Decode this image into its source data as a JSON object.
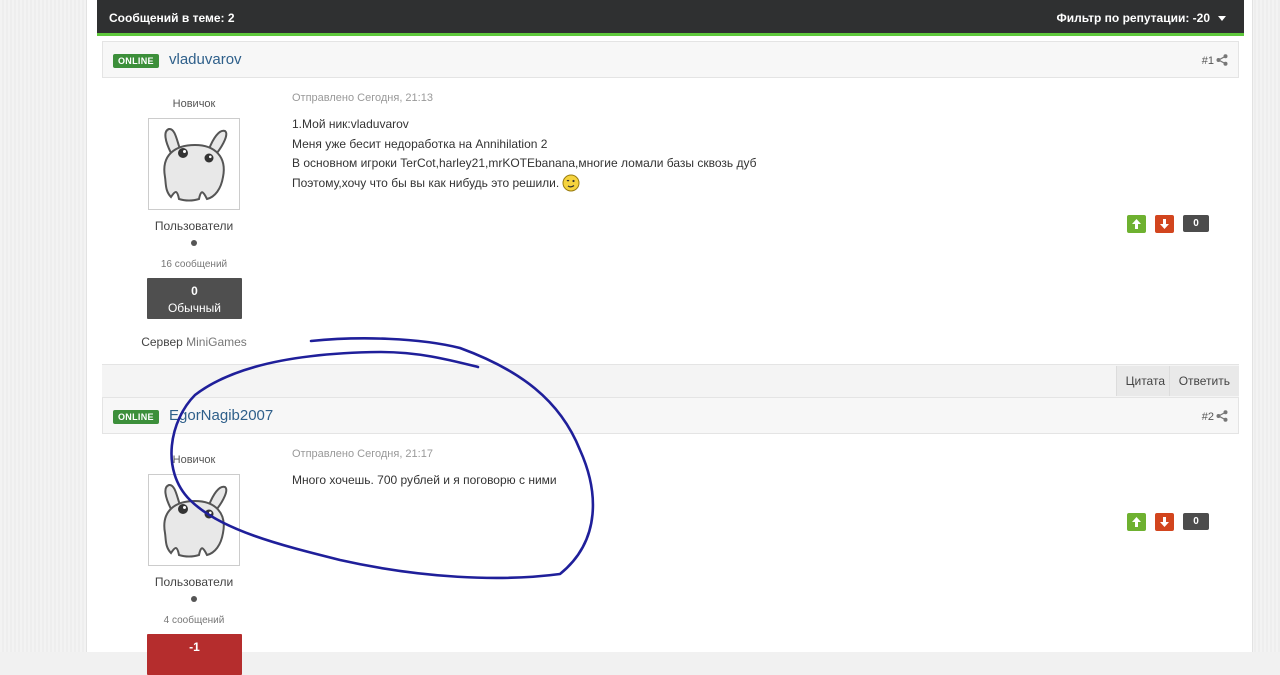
{
  "topic_bar": {
    "posts_in_topic": "Сообщений в теме: 2",
    "reputation_filter": "Фильтр по репутации: -20"
  },
  "posts": [
    {
      "online_label": "ONLINE",
      "author": "vladuvarov",
      "post_number": "#1",
      "rank": "Новичок",
      "group": "Пользователи",
      "post_count": "16 сообщений",
      "reputation_value": "0",
      "reputation_label": "Обычный",
      "server_prefix": "Сервер ",
      "server_name": "MiniGames",
      "posted_on": "Отправлено Сегодня, 21:13",
      "lines": [
        "1.Мой ник:vladuvarov",
        "Меня уже бесит недоработка на Annihilation 2",
        "В основном игроки TerCot,harley21,mrKOTEbanana,многие ломали базы сквозь дуб",
        "Поэтому,хочу что бы вы как нибудь это решили."
      ],
      "vote_count": "0",
      "quote_label": "Цитата",
      "reply_label": "Ответить"
    },
    {
      "online_label": "ONLINE",
      "author": "EgorNagib2007",
      "post_number": "#2",
      "rank": "Новичок",
      "group": "Пользователи",
      "post_count": "4 сообщений",
      "reputation_value": "-1",
      "posted_on": "Отправлено Сегодня, 21:17",
      "lines": [
        "Много хочешь. 700 рублей и я поговорю с ними"
      ],
      "vote_count": "0"
    }
  ],
  "icons": {
    "share": "share-icon",
    "vote_up": "arrow-up-icon",
    "vote_down": "arrow-down-icon",
    "smiley": "wink-smiley-icon",
    "caret": "caret-down-icon"
  },
  "colors": {
    "online": "#3c8f3a",
    "accent_bar": "#5ec83b",
    "vote_up": "#6eb130",
    "vote_down": "#d2451e",
    "negative_rep": "#b52d2d",
    "annotation": "#1f1f9a"
  }
}
